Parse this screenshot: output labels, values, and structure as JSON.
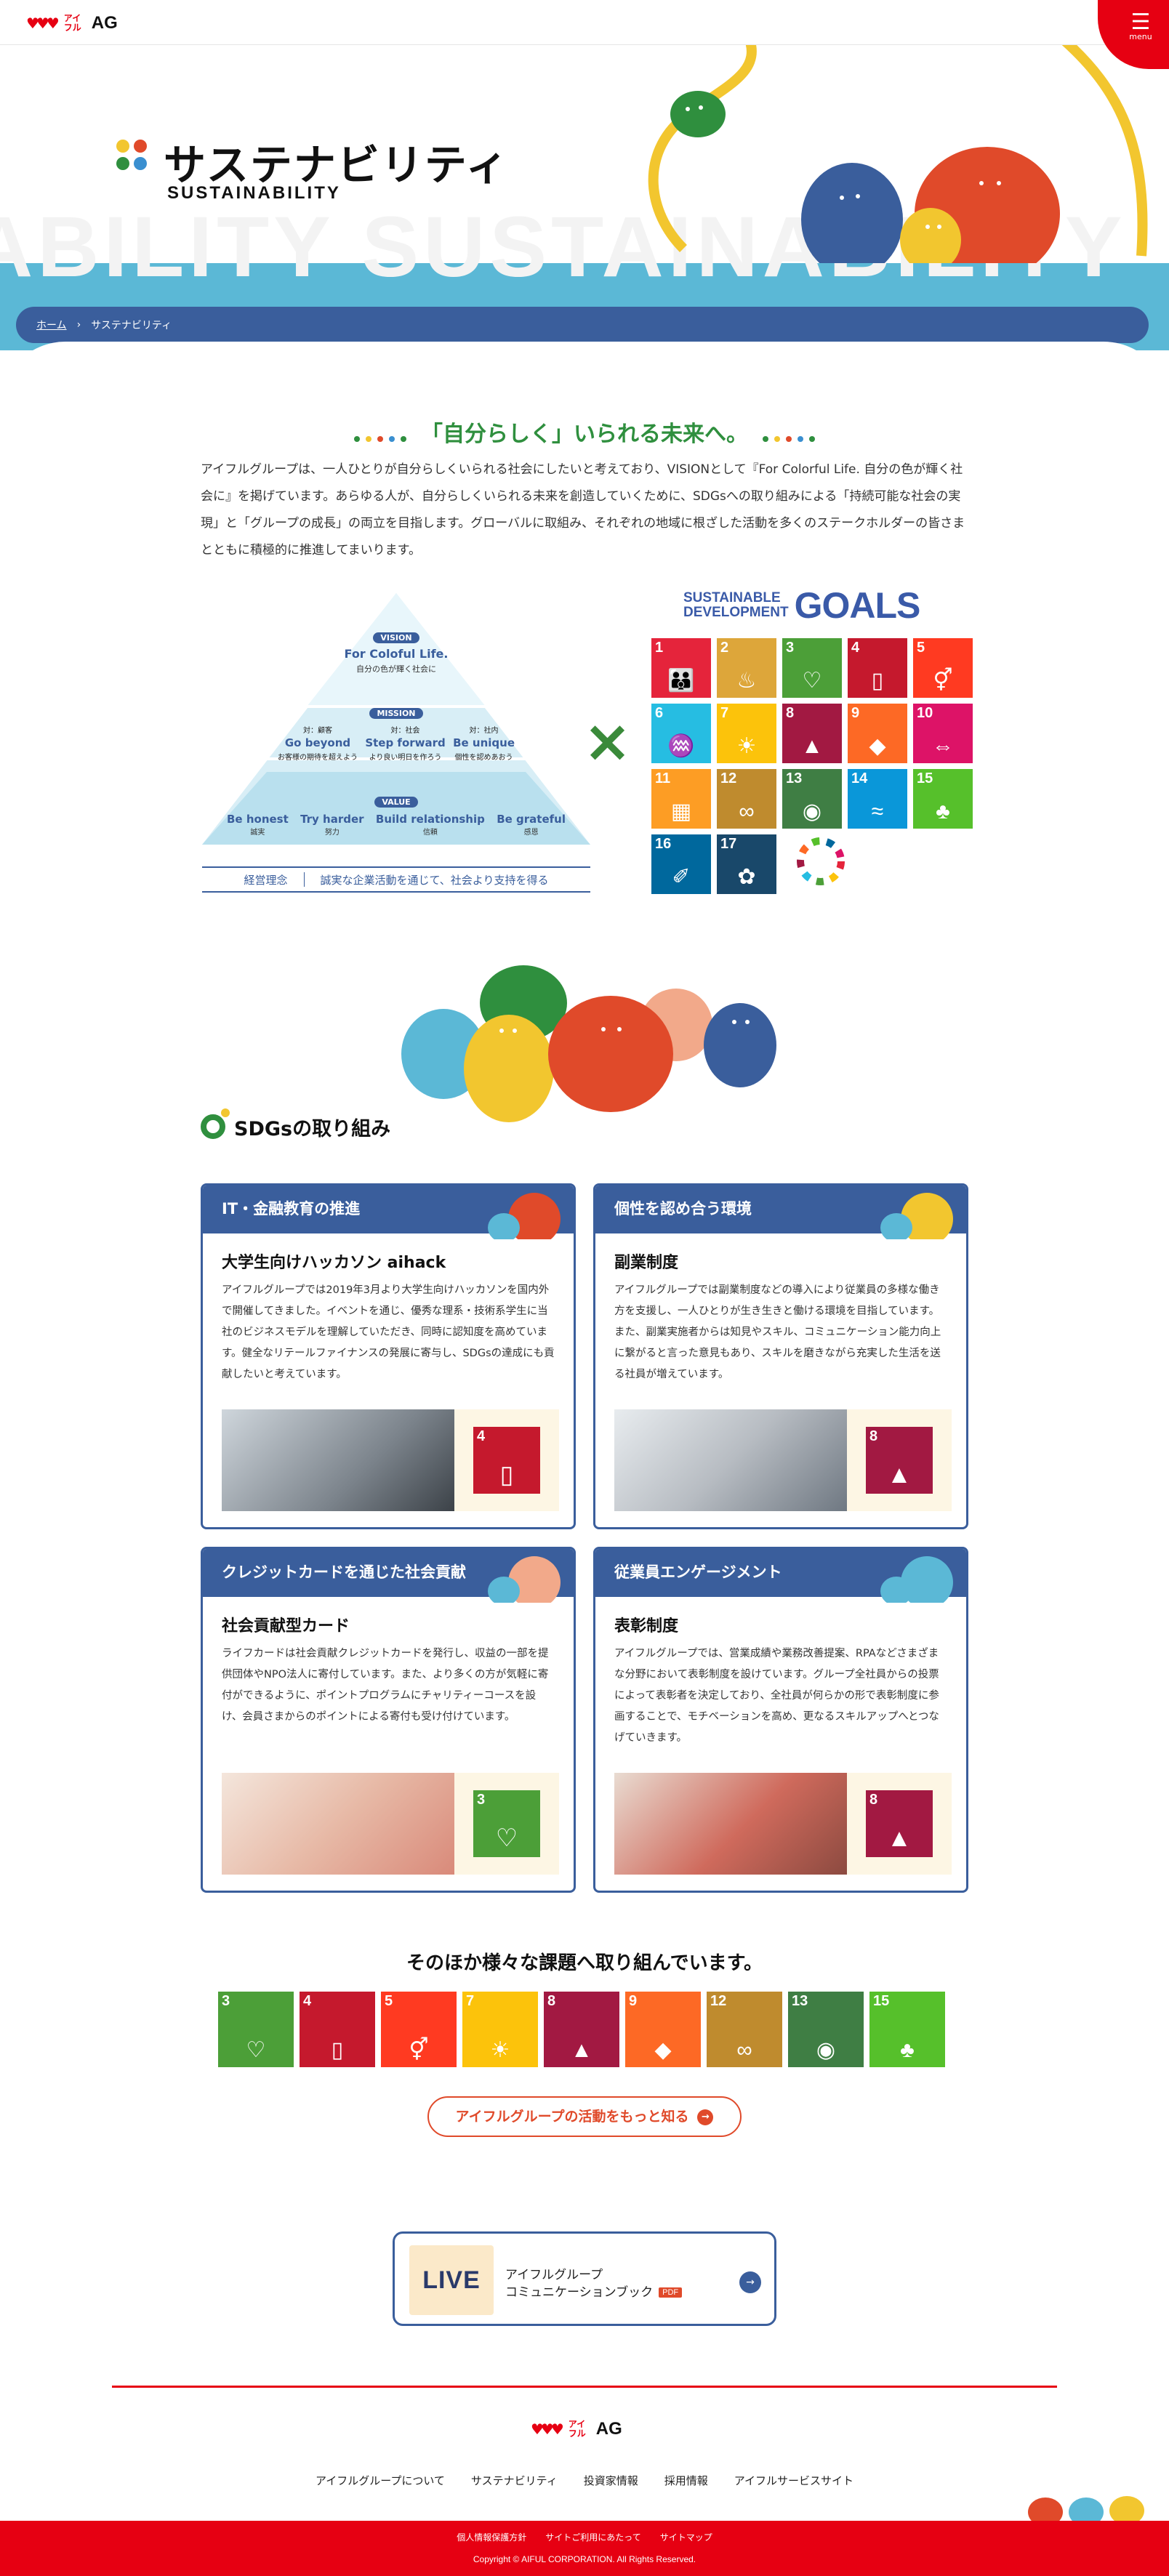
{
  "header": {
    "logo_hearts": "♥♥♥",
    "logo_kana": "アイフル",
    "logo_ag": "AG",
    "menu_icon": "☰",
    "menu_label": "menu"
  },
  "hero": {
    "title": "サステナビリティ",
    "subtitle": "SUSTAINABILITY",
    "background_word": "ABILITY SUSTAINABILITY"
  },
  "breadcrumb": {
    "home": "ホーム",
    "separator": "›",
    "current": "サステナビリティ"
  },
  "intro": {
    "title": "「自分らしく」いられる未来へ。",
    "text": "アイフルグループは、一人ひとりが自分らしくいられる社会にしたいと考えており、VISIONとして『For Colorful Life. 自分の色が輝く社会に』を掲げています。あらゆる人が、自分らしくいられる未来を創造していくために、SDGsへの取り組みによる「持続可能な社会の実現」と「グループの成長」の両立を目指します。グローバルに取組み、それぞれの地域に根ざした活動を多くのステークホルダーの皆さまとともに積極的に推進してまいります。"
  },
  "pyramid": {
    "vision_badge": "VISION",
    "vision_en": "For Coloful Life.",
    "vision_jp": "自分の色が輝く社会に",
    "mission_badge": "MISSION",
    "missions": [
      {
        "label": "対：顧客",
        "en": "Go beyond",
        "jp": "お客様の期待を超えよう"
      },
      {
        "label": "対：社会",
        "en": "Step forward",
        "jp": "より良い明日を作ろう"
      },
      {
        "label": "対：社内",
        "en": "Be unique",
        "jp": "個性を認めあおう"
      }
    ],
    "value_badge": "VALUE",
    "values": [
      {
        "en": "Be honest",
        "jp": "誠実"
      },
      {
        "en": "Try harder",
        "jp": "努力"
      },
      {
        "en": "Build relationship",
        "jp": "信頼"
      },
      {
        "en": "Be grateful",
        "jp": "感恩"
      }
    ],
    "philosophy_label": "経営理念",
    "philosophy_text": "誠実な企業活動を通じて、社会より支持を得る"
  },
  "times_symbol": "×",
  "sdgs": {
    "head_line1": "SUSTAINABLE",
    "head_line2": "DEVELOPMENT",
    "head_goals": "GOALS",
    "tiles": [
      {
        "n": "1",
        "color": "#e5243b",
        "icon": "people-icon",
        "glyph": "👪"
      },
      {
        "n": "2",
        "color": "#dda63a",
        "icon": "bowl-icon",
        "glyph": "♨"
      },
      {
        "n": "3",
        "color": "#4c9f38",
        "icon": "heartbeat-icon",
        "glyph": "♡"
      },
      {
        "n": "4",
        "color": "#c5192d",
        "icon": "book-icon",
        "glyph": "▯"
      },
      {
        "n": "5",
        "color": "#ff3a21",
        "icon": "gender-icon",
        "glyph": "⚥"
      },
      {
        "n": "6",
        "color": "#26bde2",
        "icon": "water-icon",
        "glyph": "♒"
      },
      {
        "n": "7",
        "color": "#fcc30b",
        "icon": "sun-icon",
        "glyph": "☀"
      },
      {
        "n": "8",
        "color": "#a21942",
        "icon": "growth-icon",
        "glyph": "▲"
      },
      {
        "n": "9",
        "color": "#fd6925",
        "icon": "cubes-icon",
        "glyph": "◆"
      },
      {
        "n": "10",
        "color": "#dd1367",
        "icon": "equal-icon",
        "glyph": "⇔"
      },
      {
        "n": "11",
        "color": "#fd9d24",
        "icon": "city-icon",
        "glyph": "▦"
      },
      {
        "n": "12",
        "color": "#bf8b2e",
        "icon": "infinity-icon",
        "glyph": "∞"
      },
      {
        "n": "13",
        "color": "#3f7e44",
        "icon": "eye-icon",
        "glyph": "◉"
      },
      {
        "n": "14",
        "color": "#0a97d9",
        "icon": "fish-icon",
        "glyph": "≈"
      },
      {
        "n": "15",
        "color": "#56c02b",
        "icon": "tree-icon",
        "glyph": "♣"
      },
      {
        "n": "16",
        "color": "#00689d",
        "icon": "dove-icon",
        "glyph": "✐"
      },
      {
        "n": "17",
        "color": "#19486a",
        "icon": "flower-icon",
        "glyph": "✿"
      }
    ]
  },
  "section": {
    "title": "SDGsの取り組み"
  },
  "cards": [
    {
      "header": "IT・金融教育の推進",
      "subtitle": "大学生向けハッカソン aihack",
      "text": "アイフルグループでは2019年3月より大学生向けハッカソンを国内外で開催してきました。イベントを通じ、優秀な理系・技術系学生に当社のビジネスモデルを理解していただき、同時に認知度を高めています。健全なリテールファイナンスの発展に寄与し、SDGsの達成にも貢献したいと考えています。",
      "goal_n": "4",
      "goal_color": "#c5192d",
      "goal_glyph": "▯"
    },
    {
      "header": "個性を認め合う環境",
      "subtitle": "副業制度",
      "text": "アイフルグループでは副業制度などの導入により従業員の多様な働き方を支援し、一人ひとりが生き生きと働ける環境を目指しています。また、副業実施者からは知見やスキル、コミュニケーション能力向上に繋がると言った意見もあり、スキルを磨きながら充実した生活を送る社員が増えています。",
      "goal_n": "8",
      "goal_color": "#a21942",
      "goal_glyph": "▲"
    },
    {
      "header": "クレジットカードを通じた社会貢献",
      "subtitle": "社会貢献型カード",
      "text": "ライフカードは社会貢献クレジットカードを発行し、収益の一部を提供団体やNPO法人に寄付しています。また、より多くの方が気軽に寄付ができるように、ポイントプログラムにチャリティーコースを設け、会員さまからのポイントによる寄付も受け付けています。",
      "goal_n": "3",
      "goal_color": "#4c9f38",
      "goal_glyph": "♡"
    },
    {
      "header": "従業員エンゲージメント",
      "subtitle": "表彰制度",
      "text": "アイフルグループでは、営業成績や業務改善提案、RPAなどさまざまな分野において表彰制度を設けています。グループ全社員からの投票によって表彰者を決定しており、全社員が何らかの形で表彰制度に参画することで、モチベーションを高め、更なるスキルアップへとつなげていきます。",
      "goal_n": "8",
      "goal_color": "#a21942",
      "goal_glyph": "▲"
    }
  ],
  "other": {
    "title": "そのほか様々な課題へ取り組んでいます。",
    "tiles": [
      {
        "n": "3",
        "color": "#4c9f38",
        "icon": "heartbeat-icon",
        "glyph": "♡"
      },
      {
        "n": "4",
        "color": "#c5192d",
        "icon": "book-icon",
        "glyph": "▯"
      },
      {
        "n": "5",
        "color": "#ff3a21",
        "icon": "gender-icon",
        "glyph": "⚥"
      },
      {
        "n": "7",
        "color": "#fcc30b",
        "icon": "sun-icon",
        "glyph": "☀"
      },
      {
        "n": "8",
        "color": "#a21942",
        "icon": "growth-icon",
        "glyph": "▲"
      },
      {
        "n": "9",
        "color": "#fd6925",
        "icon": "cubes-icon",
        "glyph": "◆"
      },
      {
        "n": "12",
        "color": "#bf8b2e",
        "icon": "infinity-icon",
        "glyph": "∞"
      },
      {
        "n": "13",
        "color": "#3f7e44",
        "icon": "eye-icon",
        "glyph": "◉"
      },
      {
        "n": "15",
        "color": "#56c02b",
        "icon": "tree-icon",
        "glyph": "♣"
      }
    ],
    "more_button": "アイフルグループの活動をもっと知る",
    "more_arrow": "→"
  },
  "book": {
    "cover_text": "LIVE",
    "line1": "アイフルグループ",
    "line2": "コミュニケーションブック",
    "badge": "PDF",
    "arrow": "→"
  },
  "footer": {
    "nav": [
      "アイフルグループについて",
      "サステナビリティ",
      "投資家情報",
      "採用情報",
      "アイフルサービスサイト"
    ],
    "links": [
      "個人情報保護方針",
      "サイトご利用にあたって",
      "サイトマップ"
    ],
    "copyright": "Copyright © AIFUL CORPORATION. All Rights Reserved."
  }
}
